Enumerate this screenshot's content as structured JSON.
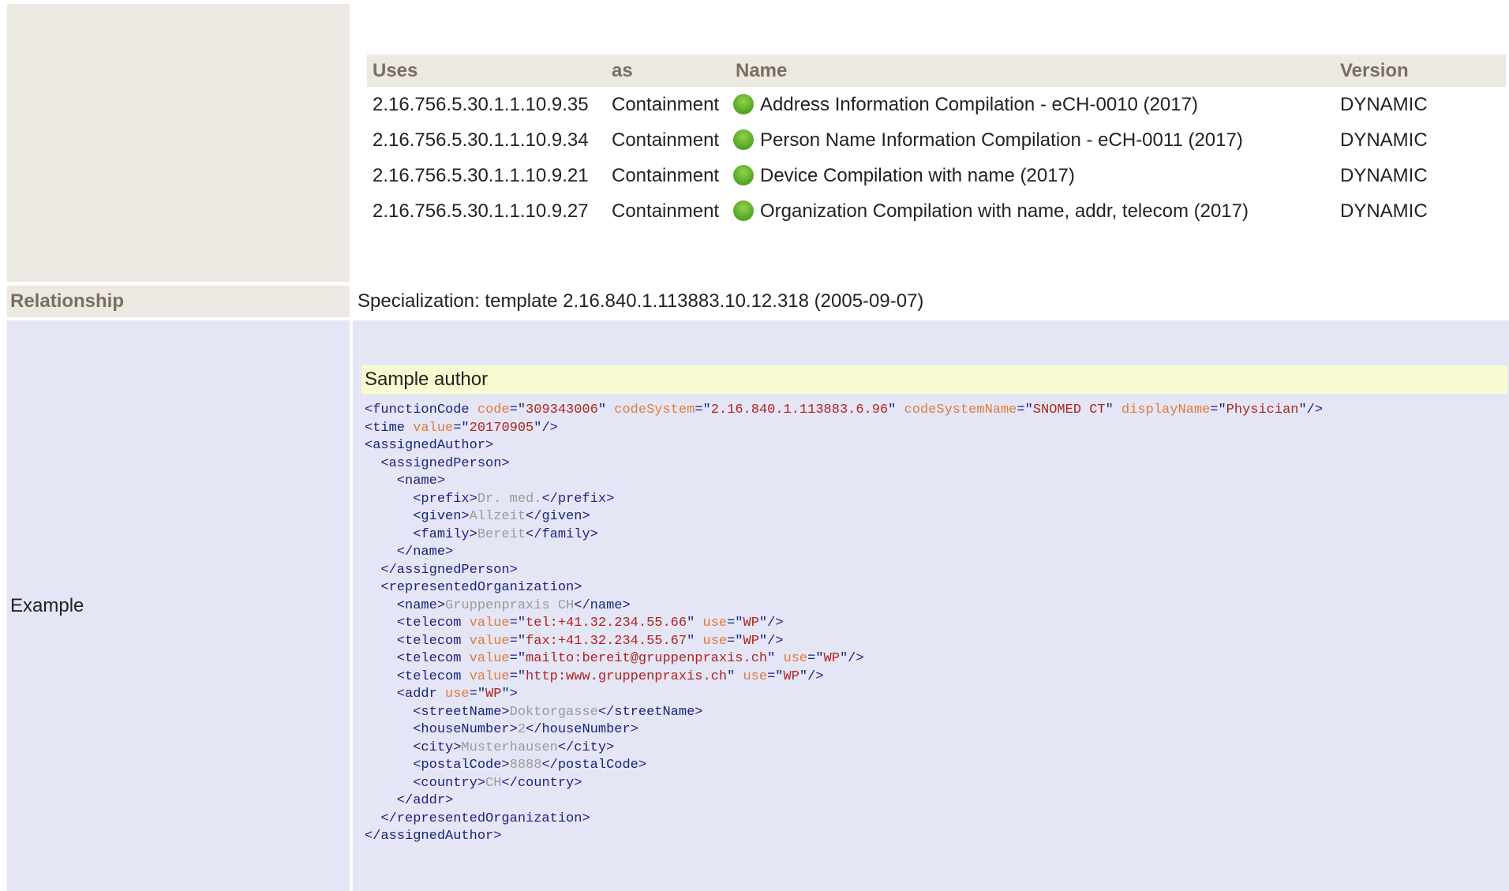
{
  "uses": {
    "headers": {
      "uses": "Uses",
      "as": "as",
      "name": "Name",
      "version": "Version"
    },
    "rows": [
      {
        "oid": "2.16.756.5.30.1.1.10.9.35",
        "as": "Containment",
        "name": "Address Information Compilation - eCH-0010 (2017)",
        "version": "DYNAMIC",
        "status_icon": "active-status-dot-icon"
      },
      {
        "oid": "2.16.756.5.30.1.1.10.9.34",
        "as": "Containment",
        "name": "Person Name Information Compilation - eCH-0011 (2017)",
        "version": "DYNAMIC",
        "status_icon": "active-status-dot-icon"
      },
      {
        "oid": "2.16.756.5.30.1.1.10.9.21",
        "as": "Containment",
        "name": "Device Compilation with name (2017)",
        "version": "DYNAMIC",
        "status_icon": "active-status-dot-icon"
      },
      {
        "oid": "2.16.756.5.30.1.1.10.9.27",
        "as": "Containment",
        "name": "Organization Compilation with name, addr, telecom (2017)",
        "version": "DYNAMIC",
        "status_icon": "active-status-dot-icon"
      }
    ]
  },
  "relationship": {
    "label": "Relationship",
    "value": "Specialization: template 2.16.840.1.113883.10.12.318 (2005-09-07)"
  },
  "example": {
    "label": "Example",
    "title": "Sample author",
    "code_lines": [
      [
        [
          "tag",
          "<functionCode "
        ],
        [
          "attr",
          "code"
        ],
        [
          "tag",
          "=\""
        ],
        [
          "val",
          "309343006"
        ],
        [
          "tag",
          "\" "
        ],
        [
          "attr",
          "codeSystem"
        ],
        [
          "tag",
          "=\""
        ],
        [
          "val",
          "2.16.840.1.113883.6.96"
        ],
        [
          "tag",
          "\" "
        ],
        [
          "attr",
          "codeSystemName"
        ],
        [
          "tag",
          "=\""
        ],
        [
          "val",
          "SNOMED CT"
        ],
        [
          "tag",
          "\" "
        ],
        [
          "attr",
          "displayName"
        ],
        [
          "tag",
          "=\""
        ],
        [
          "val",
          "Physician"
        ],
        [
          "tag",
          "\"/>"
        ]
      ],
      [
        [
          "tag",
          "<time "
        ],
        [
          "attr",
          "value"
        ],
        [
          "tag",
          "=\""
        ],
        [
          "val",
          "20170905"
        ],
        [
          "tag",
          "\"/>"
        ]
      ],
      [
        [
          "tag",
          "<assignedAuthor>"
        ]
      ],
      [
        [
          "tag",
          "  <assignedPerson>"
        ]
      ],
      [
        [
          "tag",
          "    <name>"
        ]
      ],
      [
        [
          "tag",
          "      <prefix>"
        ],
        [
          "txt",
          "Dr. med."
        ],
        [
          "tag",
          "</prefix>"
        ]
      ],
      [
        [
          "tag",
          "      <given>"
        ],
        [
          "txt",
          "Allzeit"
        ],
        [
          "tag",
          "</given>"
        ]
      ],
      [
        [
          "tag",
          "      <family>"
        ],
        [
          "txt",
          "Bereit"
        ],
        [
          "tag",
          "</family>"
        ]
      ],
      [
        [
          "tag",
          "    </name>"
        ]
      ],
      [
        [
          "tag",
          "  </assignedPerson>"
        ]
      ],
      [
        [
          "tag",
          "  <representedOrganization>"
        ]
      ],
      [
        [
          "tag",
          "    <name>"
        ],
        [
          "txt",
          "Gruppenpraxis CH"
        ],
        [
          "tag",
          "</name>"
        ]
      ],
      [
        [
          "tag",
          "    <telecom "
        ],
        [
          "attr",
          "value"
        ],
        [
          "tag",
          "=\""
        ],
        [
          "val",
          "tel:+41.32.234.55.66"
        ],
        [
          "tag",
          "\" "
        ],
        [
          "attr",
          "use"
        ],
        [
          "tag",
          "=\""
        ],
        [
          "val",
          "WP"
        ],
        [
          "tag",
          "\"/>"
        ]
      ],
      [
        [
          "tag",
          "    <telecom "
        ],
        [
          "attr",
          "value"
        ],
        [
          "tag",
          "=\""
        ],
        [
          "val",
          "fax:+41.32.234.55.67"
        ],
        [
          "tag",
          "\" "
        ],
        [
          "attr",
          "use"
        ],
        [
          "tag",
          "=\""
        ],
        [
          "val",
          "WP"
        ],
        [
          "tag",
          "\"/>"
        ]
      ],
      [
        [
          "tag",
          "    <telecom "
        ],
        [
          "attr",
          "value"
        ],
        [
          "tag",
          "=\""
        ],
        [
          "val",
          "mailto:bereit@gruppenpraxis.ch"
        ],
        [
          "tag",
          "\" "
        ],
        [
          "attr",
          "use"
        ],
        [
          "tag",
          "=\""
        ],
        [
          "val",
          "WP"
        ],
        [
          "tag",
          "\"/>"
        ]
      ],
      [
        [
          "tag",
          "    <telecom "
        ],
        [
          "attr",
          "value"
        ],
        [
          "tag",
          "=\""
        ],
        [
          "val",
          "http:www.gruppenpraxis.ch"
        ],
        [
          "tag",
          "\" "
        ],
        [
          "attr",
          "use"
        ],
        [
          "tag",
          "=\""
        ],
        [
          "val",
          "WP"
        ],
        [
          "tag",
          "\"/>"
        ]
      ],
      [
        [
          "tag",
          "    <addr "
        ],
        [
          "attr",
          "use"
        ],
        [
          "tag",
          "=\""
        ],
        [
          "val",
          "WP"
        ],
        [
          "tag",
          "\">"
        ]
      ],
      [
        [
          "tag",
          "      <streetName>"
        ],
        [
          "txt",
          "Doktorgasse"
        ],
        [
          "tag",
          "</streetName>"
        ]
      ],
      [
        [
          "tag",
          "      <houseNumber>"
        ],
        [
          "txt",
          "2"
        ],
        [
          "tag",
          "</houseNumber>"
        ]
      ],
      [
        [
          "tag",
          "      <city>"
        ],
        [
          "txt",
          "Musterhausen"
        ],
        [
          "tag",
          "</city>"
        ]
      ],
      [
        [
          "tag",
          "      <postalCode>"
        ],
        [
          "txt",
          "8888"
        ],
        [
          "tag",
          "</postalCode>"
        ]
      ],
      [
        [
          "tag",
          "      <country>"
        ],
        [
          "txt",
          "CH"
        ],
        [
          "tag",
          "</country>"
        ]
      ],
      [
        [
          "tag",
          "    </addr>"
        ]
      ],
      [
        [
          "tag",
          "  </representedOrganization>"
        ]
      ],
      [
        [
          "tag",
          "</assignedAuthor>"
        ]
      ]
    ]
  },
  "colors": {
    "label_bg": "#ece9e3",
    "label_text": "#7a6e5f",
    "example_bg": "#e4e6f6",
    "sample_title_bg": "#fafad2",
    "xml_tag": "#1a237e",
    "xml_attr": "#e07b3b",
    "xml_value": "#b0231d",
    "xml_text": "#9a9a9a",
    "status_active": "#5faf2a"
  }
}
